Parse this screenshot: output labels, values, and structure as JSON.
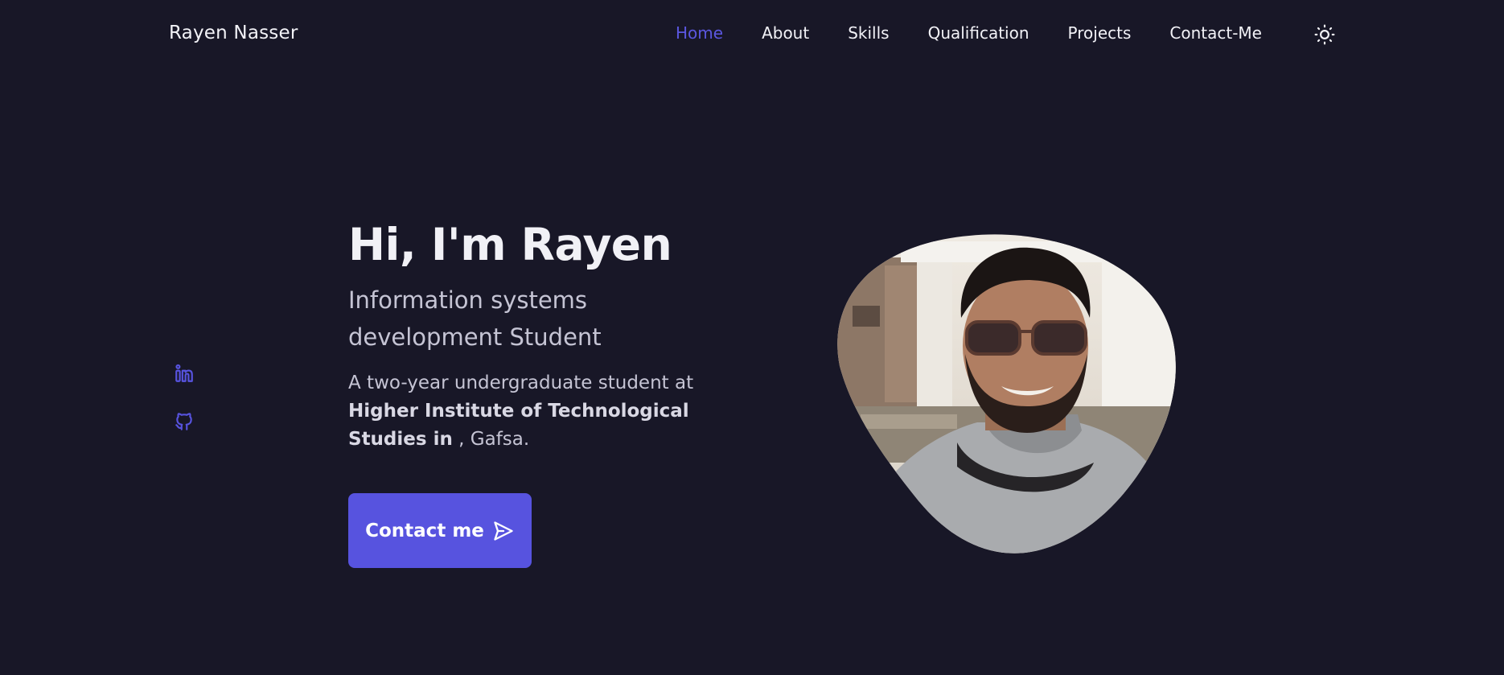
{
  "header": {
    "logo": "Rayen Nasser",
    "nav": [
      {
        "label": "Home",
        "active": true
      },
      {
        "label": "About",
        "active": false
      },
      {
        "label": "Skills",
        "active": false
      },
      {
        "label": "Qualification",
        "active": false
      },
      {
        "label": "Projects",
        "active": false
      },
      {
        "label": "Contact-Me",
        "active": false
      }
    ],
    "theme_icon": "sun-icon"
  },
  "social": [
    {
      "icon": "linkedin-icon"
    },
    {
      "icon": "github-icon"
    }
  ],
  "hero": {
    "title": "Hi, I'm Rayen",
    "subtitle": "Information systems development Student",
    "description_prefix": "A two-year undergraduate student at",
    "description_bold": "Higher Institute of Technological Studies in",
    "description_suffix": ", Gafsa.",
    "button_label": "Contact me",
    "button_icon": "send-icon",
    "profile_image": "profile-photo"
  },
  "colors": {
    "background": "#181727",
    "accent": "#5753df",
    "text": "#f1f1f6",
    "muted_text": "#c5c4d4"
  }
}
